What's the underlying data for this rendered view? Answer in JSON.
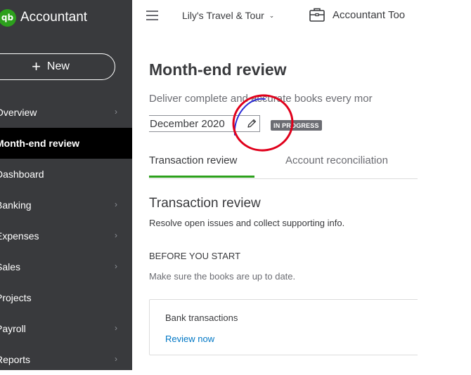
{
  "app": {
    "brand_logo": "qb",
    "brand_name": "Accountant"
  },
  "sidebar": {
    "new_button": {
      "icon": "plus-icon",
      "label": "New"
    },
    "items": [
      {
        "label": "Overview",
        "has_chevron": true,
        "active": false
      },
      {
        "label": "Month-end review",
        "has_chevron": false,
        "active": true
      },
      {
        "label": "Dashboard",
        "has_chevron": false,
        "active": false
      },
      {
        "label": "Banking",
        "has_chevron": true,
        "active": false
      },
      {
        "label": "Expenses",
        "has_chevron": true,
        "active": false
      },
      {
        "label": "Sales",
        "has_chevron": true,
        "active": false
      },
      {
        "label": "Projects",
        "has_chevron": false,
        "active": false
      },
      {
        "label": "Payroll",
        "has_chevron": true,
        "active": false
      },
      {
        "label": "Reports",
        "has_chevron": true,
        "active": false
      }
    ]
  },
  "topbar": {
    "menu_icon": "hamburger-icon",
    "company_name": "Lily's Travel & Tour",
    "company_caret": "chevron-down-icon",
    "tools_icon": "briefcase-icon",
    "tools_label": "Accountant Too"
  },
  "main": {
    "title": "Month-end review",
    "subtitle": "Deliver complete and accurate books every mor",
    "month_selector": {
      "value": "December 2020",
      "icon": "pencil-icon"
    },
    "status_badge": "IN PROGRESS",
    "tabs": [
      {
        "label": "Transaction review",
        "active": true
      },
      {
        "label": "Account reconciliation",
        "active": false
      }
    ],
    "section": {
      "title": "Transaction review",
      "description": "Resolve open issues and collect supporting info."
    },
    "before_you_start": {
      "title": "BEFORE YOU START",
      "description": "Make sure the books are up to date."
    },
    "card": {
      "title": "Bank transactions",
      "link": "Review now"
    }
  },
  "colors": {
    "sidebar_bg": "#393a3d",
    "active_item_bg": "#000000",
    "brand_green": "#2ca01c",
    "link_blue": "#0077c5",
    "annotation_red": "#e0001b",
    "annotation_blue": "#2b2bd6"
  }
}
